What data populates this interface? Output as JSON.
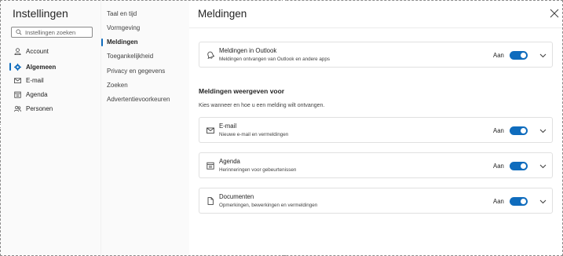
{
  "nav": {
    "title": "Instellingen",
    "search_placeholder": "Instellingen zoeken",
    "items": [
      {
        "label": "Account",
        "icon": "person-icon",
        "active": false
      },
      {
        "label": "Algemeen",
        "icon": "gear-icon",
        "active": true
      },
      {
        "label": "E-mail",
        "icon": "mail-icon",
        "active": false
      },
      {
        "label": "Agenda",
        "icon": "calendar-icon",
        "active": false
      },
      {
        "label": "Personen",
        "icon": "people-icon",
        "active": false
      }
    ]
  },
  "subnav": {
    "items": [
      {
        "label": "Taal en tijd",
        "active": false
      },
      {
        "label": "Vormgeving",
        "active": false
      },
      {
        "label": "Meldingen",
        "active": true
      },
      {
        "label": "Toegankelijkheid",
        "active": false
      },
      {
        "label": "Privacy en gegevens",
        "active": false
      },
      {
        "label": "Zoeken",
        "active": false
      },
      {
        "label": "Advertentievoorkeuren",
        "active": false
      }
    ]
  },
  "main": {
    "title": "Meldingen",
    "outlook_card": {
      "title": "Meldingen in Outlook",
      "subtitle": "Meldingen ontvangen van Outlook en andere apps",
      "state_label": "Aan",
      "icon": "bell-icon",
      "enabled": true
    },
    "section_heading": "Meldingen weergeven voor",
    "section_subtitle": "Kies wanneer en hoe u een melding wilt ontvangen.",
    "cards": [
      {
        "title": "E-mail",
        "subtitle": "Nieuwe e-mail en vermeldingen",
        "state_label": "Aan",
        "icon": "mail-icon",
        "enabled": true
      },
      {
        "title": "Agenda",
        "subtitle": "Herinneringen voor gebeurtenissen",
        "state_label": "Aan",
        "icon": "calendar-icon",
        "enabled": true
      },
      {
        "title": "Documenten",
        "subtitle": "Opmerkingen, bewerkingen en vermeldingen",
        "state_label": "Aan",
        "icon": "document-icon",
        "enabled": true
      }
    ]
  },
  "colors": {
    "accent": "#0f6cbd",
    "nav_bg": "#fafafa",
    "border": "#e0e0e0"
  }
}
